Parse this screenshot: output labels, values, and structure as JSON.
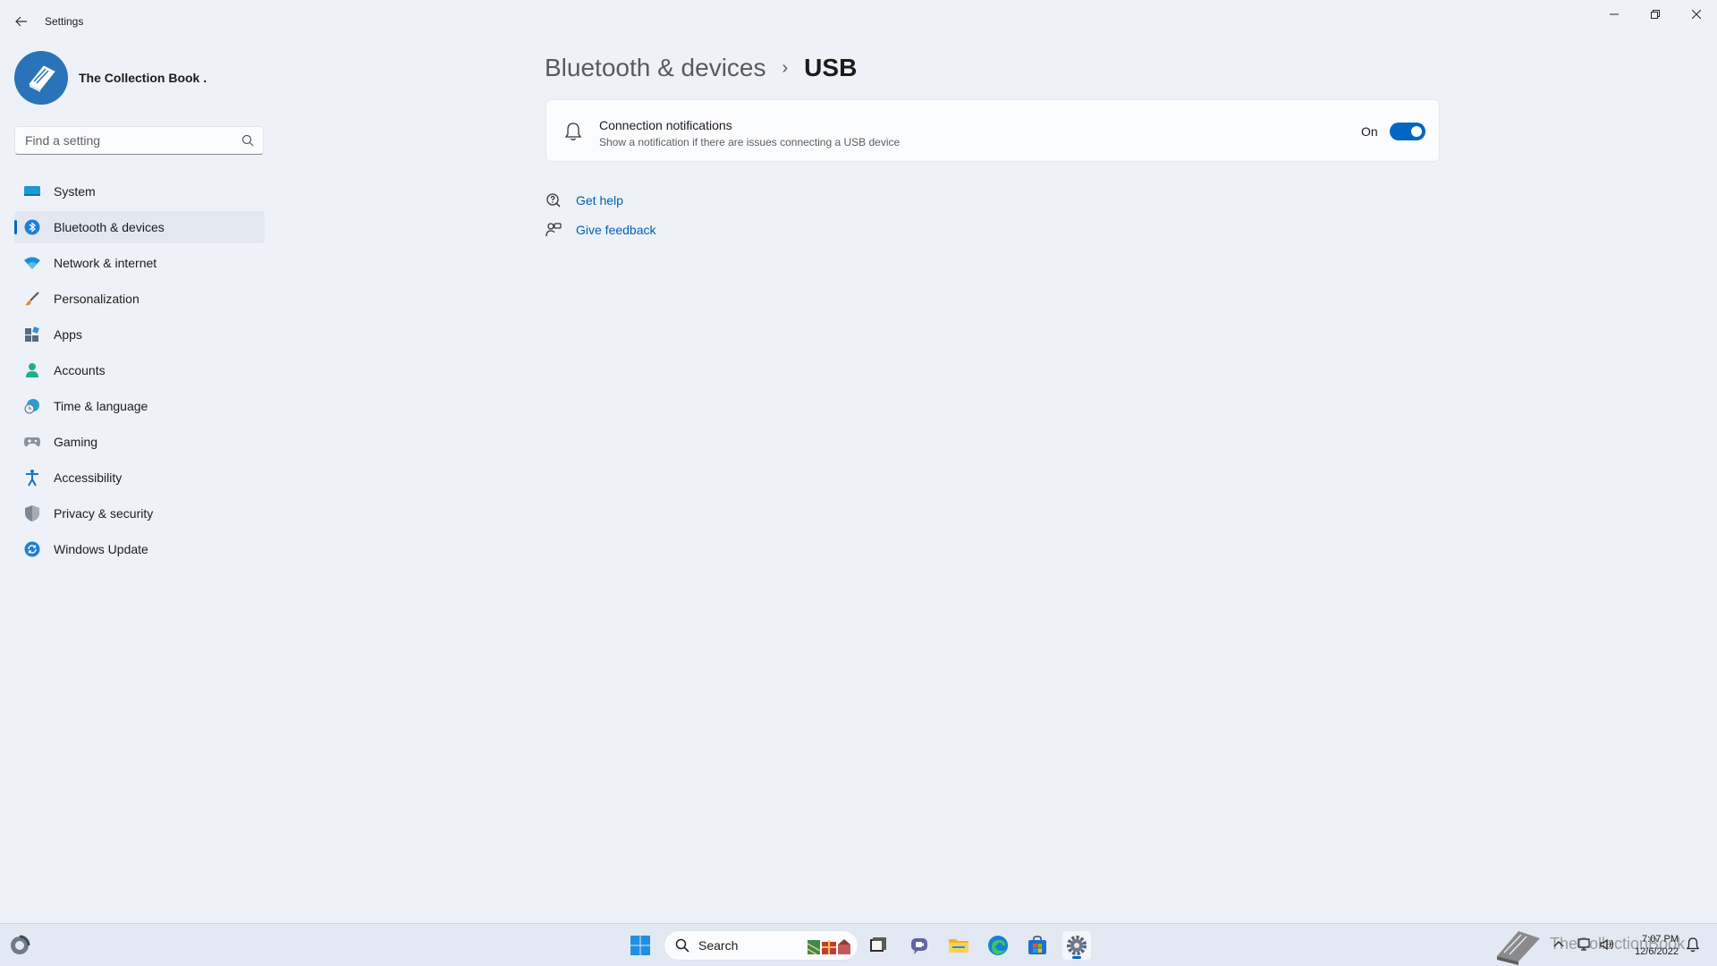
{
  "window": {
    "title": "Settings"
  },
  "profile": {
    "name": "The Collection Book ."
  },
  "search": {
    "placeholder": "Find a setting"
  },
  "nav": {
    "items": [
      {
        "label": "System",
        "icon": "system-icon"
      },
      {
        "label": "Bluetooth & devices",
        "icon": "bluetooth-icon",
        "selected": true
      },
      {
        "label": "Network & internet",
        "icon": "wifi-icon"
      },
      {
        "label": "Personalization",
        "icon": "brush-icon"
      },
      {
        "label": "Apps",
        "icon": "apps-icon"
      },
      {
        "label": "Accounts",
        "icon": "person-icon"
      },
      {
        "label": "Time & language",
        "icon": "clock-globe-icon"
      },
      {
        "label": "Gaming",
        "icon": "gamepad-icon"
      },
      {
        "label": "Accessibility",
        "icon": "accessibility-icon"
      },
      {
        "label": "Privacy & security",
        "icon": "shield-icon"
      },
      {
        "label": "Windows Update",
        "icon": "update-icon"
      }
    ]
  },
  "breadcrumb": {
    "parent": "Bluetooth & devices",
    "separator": "›",
    "current": "USB"
  },
  "connection_card": {
    "title": "Connection notifications",
    "subtitle": "Show a notification if there are issues connecting a USB device",
    "toggle_label": "On",
    "toggle_on": true
  },
  "links": {
    "help": "Get help",
    "feedback": "Give feedback"
  },
  "taskbar": {
    "search_label": "Search",
    "watermark": "TheCollectionBook",
    "time": "7:07 PM",
    "date": "12/6/2022"
  },
  "colors": {
    "accent": "#0067c0",
    "link": "#005fb8",
    "background": "#eef2f8",
    "card": "#fbfcfe"
  }
}
